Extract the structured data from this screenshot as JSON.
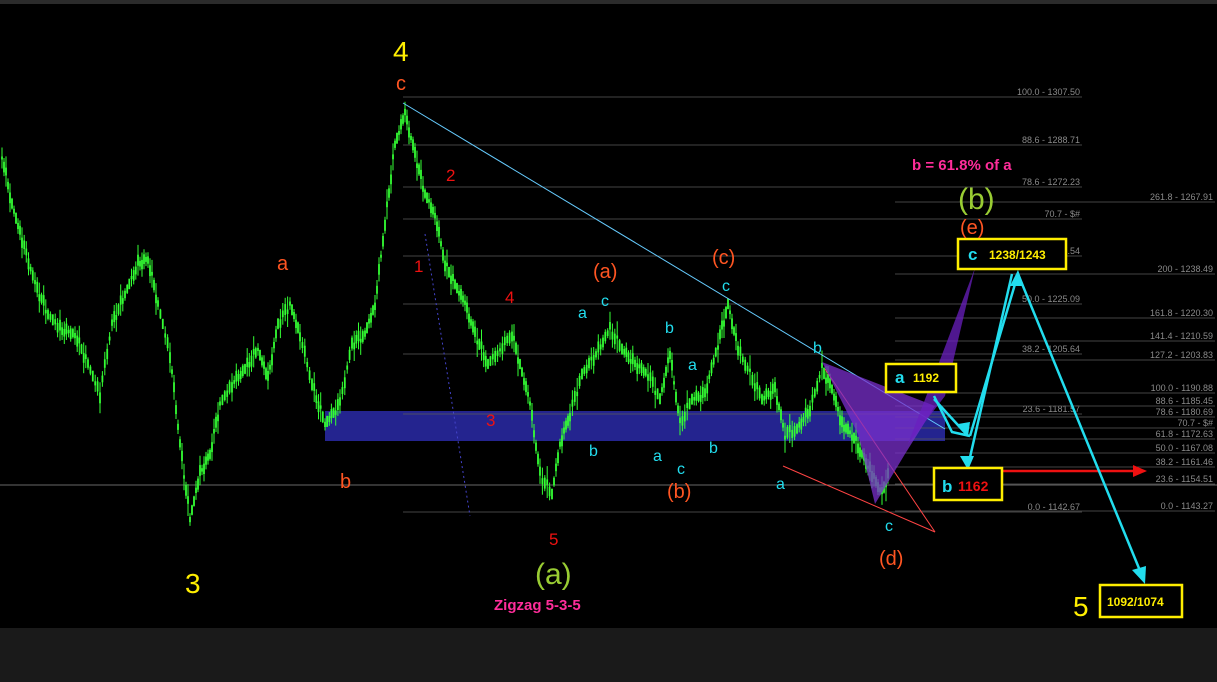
{
  "chart_data": {
    "type": "candlestick",
    "title": "",
    "subtitle": "",
    "xlabel": "",
    "ylabel": "",
    "grid": false,
    "colors": {
      "background": "#000000",
      "candles": "#33ff33",
      "zone": "#2a2aa8",
      "fib_lines": "#6a6a6a",
      "fib_text": "#8a8a8a",
      "trendline": "#66ccff",
      "arrows": "#22ddee",
      "target_box": "#ffee00",
      "red_arrow": "#ee1111",
      "wedge_fill": "#7a2fcc"
    },
    "fib_retracement_left": [
      {
        "label": "100.0 - 1307.50"
      },
      {
        "label": "88.6 - 1288.71"
      },
      {
        "label": "78.6 - 1272.23"
      },
      {
        "label": "70.7 - $#"
      },
      {
        "label": "61.8 - 1257.54"
      },
      {
        "label": "50.0 - 1225.09"
      },
      {
        "label": "38.2 - 1205.64"
      },
      {
        "label": "23.6 - 1181.57"
      },
      {
        "label": "0.0 - 1142.67"
      }
    ],
    "fib_extension_right": [
      {
        "label": "261.8 - 1267.91"
      },
      {
        "label": "200 - 1238.49"
      },
      {
        "label": "161.8 - 1220.30"
      },
      {
        "label": "141.4 - 1210.59"
      },
      {
        "label": "127.2 - 1203.83"
      },
      {
        "label": "100.0 - 1190.88"
      },
      {
        "label": "88.6 - 1185.45"
      },
      {
        "label": "78.6 - 1180.69"
      },
      {
        "label": "70.7 - $#"
      },
      {
        "label": "61.8 - 1172.63"
      },
      {
        "label": "50.0 - 1167.08"
      },
      {
        "label": "38.2 - 1161.46"
      },
      {
        "label": "23.6 - 1154.51"
      },
      {
        "label": "0.0 - 1143.27"
      }
    ],
    "wave_labels": [
      {
        "text": "4",
        "role": "major"
      },
      {
        "text": "3",
        "role": "major"
      },
      {
        "text": "5",
        "role": "major"
      },
      {
        "text": "c",
        "role": "orange"
      },
      {
        "text": "a",
        "role": "orange"
      },
      {
        "text": "b",
        "role": "orange"
      },
      {
        "text": "(a)",
        "role": "orange"
      },
      {
        "text": "(c)",
        "role": "orange"
      },
      {
        "text": "(b)",
        "role": "orange"
      },
      {
        "text": "(d)",
        "role": "orange"
      },
      {
        "text": "(e)",
        "role": "orange"
      },
      {
        "text": "1",
        "role": "red"
      },
      {
        "text": "2",
        "role": "red"
      },
      {
        "text": "3",
        "role": "red"
      },
      {
        "text": "4",
        "role": "red"
      },
      {
        "text": "5",
        "role": "red"
      },
      {
        "text": "a",
        "role": "cyan"
      },
      {
        "text": "c",
        "role": "cyan"
      },
      {
        "text": "b",
        "role": "cyan"
      },
      {
        "text": "a",
        "role": "cyan"
      },
      {
        "text": "b",
        "role": "cyan"
      },
      {
        "text": "b",
        "role": "cyan"
      },
      {
        "text": "a",
        "role": "cyan"
      },
      {
        "text": "c",
        "role": "cyan"
      },
      {
        "text": "b",
        "role": "cyan"
      },
      {
        "text": "c",
        "role": "cyan"
      },
      {
        "text": "b",
        "role": "cyan"
      },
      {
        "text": "a",
        "role": "cyan"
      },
      {
        "text": "c",
        "role": "cyan"
      },
      {
        "text": "(a)",
        "role": "green"
      },
      {
        "text": "(b)",
        "role": "green"
      }
    ],
    "annotations": {
      "zigzag": "Zigzag 5-3-5",
      "ratio": "b = 61.8% of a"
    },
    "boxes": [
      {
        "letter": "c",
        "value": "1238/1243"
      },
      {
        "letter": "a",
        "value": "1192"
      },
      {
        "letter": "b",
        "value": "1162"
      },
      {
        "letter": "",
        "value": "1092/1074"
      }
    ]
  }
}
